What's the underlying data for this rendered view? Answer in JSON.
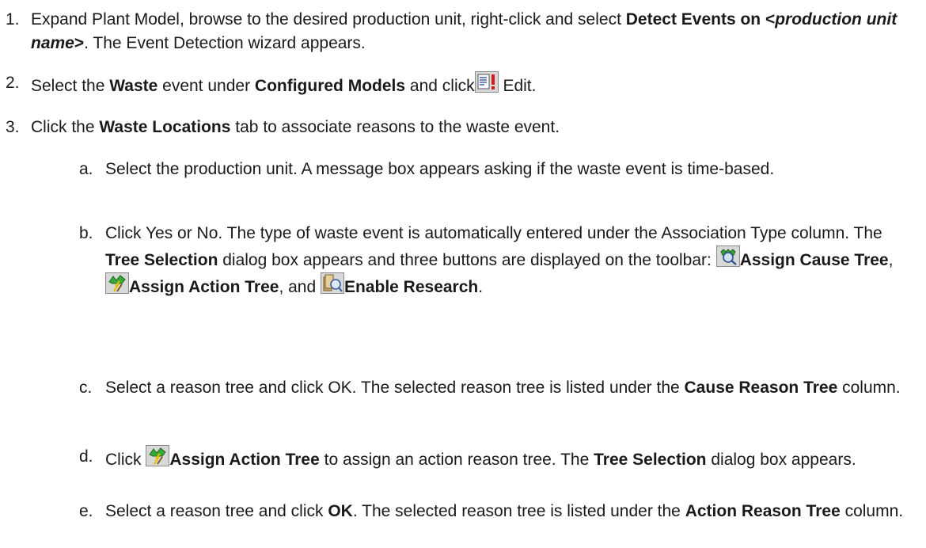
{
  "steps": [
    {
      "num": "1.",
      "t1": "Expand Plant Model, browse to the desired production unit, right-click and select ",
      "b1": "Detect Events on <",
      "bi1": "production unit name",
      "b2": ">",
      "t2": ". The Event Detection wizard appears."
    },
    {
      "num": "2.",
      "t1": "Select the ",
      "b1": "Waste",
      "t2": " event under ",
      "b2": "Configured Models",
      "t3": " and click",
      "t4": " Edit."
    },
    {
      "num": "3.",
      "t1": "Click the ",
      "b1": "Waste Locations",
      "t2": " tab to associate reasons to the waste event."
    }
  ],
  "substeps": [
    {
      "num": "a.",
      "t1": "Select the production unit. A message box appears asking if the waste event is time-based."
    },
    {
      "num": "b.",
      "t1": "Click Yes or No. The type of waste event is automatically entered under the Association Type column. The ",
      "b1": "Tree Selection",
      "t2": " dialog box appears and three buttons are displayed on the toolbar: ",
      "b2": "Assign Cause Tree",
      "t3": ", ",
      "b3": "Assign Action Tree",
      "t4": ", and ",
      "b4": "Enable Research",
      "t5": "."
    },
    {
      "num": "c.",
      "t1": "Select a reason tree and click OK. The selected reason tree is listed under the ",
      "b1": "Cause Reason Tree",
      "t2": " column."
    },
    {
      "num": "d.",
      "t1": "Click ",
      "b1": "Assign Action Tree",
      "t2": " to assign an action reason tree. The ",
      "b2": "Tree Selection",
      "t3": " dialog box appears."
    },
    {
      "num": "e.",
      "t1": "Select a reason tree and click ",
      "b1": "OK",
      "t2": ". The selected reason tree is listed under the ",
      "b2": "Action Reason Tree",
      "t3": " column."
    }
  ],
  "icons": {
    "edit": "edit-document-icon",
    "cause_tree": "assign-cause-tree-icon",
    "action_tree": "assign-action-tree-icon",
    "research": "enable-research-icon"
  }
}
